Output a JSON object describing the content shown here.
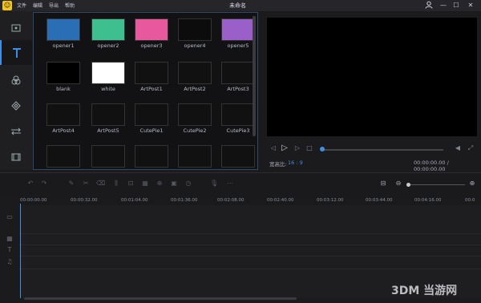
{
  "app": {
    "logo": "☺",
    "title": "未命名",
    "menu": [
      "文件",
      "编辑",
      "导出",
      "帮助"
    ]
  },
  "window_controls": {
    "user": "user-icon",
    "minimize": "—",
    "maximize": "☐",
    "close": "✕"
  },
  "library": {
    "tiles": [
      {
        "name": "opener1",
        "bg": "#2a6fb5"
      },
      {
        "name": "opener2",
        "bg": "#3dbf8f"
      },
      {
        "name": "opener3",
        "bg": "#e8589c"
      },
      {
        "name": "opener4",
        "bg": "#0c0c0c"
      },
      {
        "name": "opener5",
        "bg": "#9a5fc9"
      },
      {
        "name": "blank",
        "bg": "#000000"
      },
      {
        "name": "white",
        "bg": "#ffffff"
      },
      {
        "name": "ArtPost1",
        "bg": "#111111"
      },
      {
        "name": "ArtPost2",
        "bg": "#111111"
      },
      {
        "name": "ArtPost3",
        "bg": "#111111"
      },
      {
        "name": "ArtPost4",
        "bg": "#111111"
      },
      {
        "name": "ArtPost5",
        "bg": "#111111"
      },
      {
        "name": "CutePie1",
        "bg": "#111111"
      },
      {
        "name": "CutePie2",
        "bg": "#111111"
      },
      {
        "name": "CutePie3",
        "bg": "#111111"
      },
      {
        "name": "",
        "bg": "#111111"
      },
      {
        "name": "",
        "bg": "#111111"
      },
      {
        "name": "",
        "bg": "#111111"
      },
      {
        "name": "",
        "bg": "#111111"
      },
      {
        "name": "",
        "bg": "#111111"
      }
    ]
  },
  "preview": {
    "ratio_label": "宽高比:",
    "ratio_value": "16 : 9",
    "timecode": "00:00:00.00 / 00:00:00.00"
  },
  "timeline": {
    "ticks": [
      "00:00:00.00",
      "00:00:32.00",
      "00:01:04.00",
      "00:01:36.00",
      "00:02:08.00",
      "00:02:40.00",
      "00:03:12.00",
      "00:03:44.00",
      "00:04:16.00",
      "00:0"
    ]
  },
  "watermark": "3DM 当游网",
  "colors": {
    "accent": "#3d8fe6",
    "logo": "#f5c518"
  }
}
